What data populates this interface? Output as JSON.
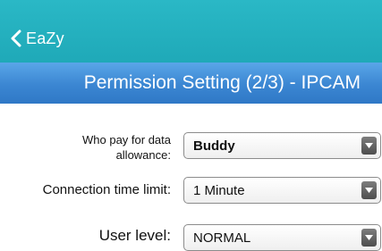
{
  "nav": {
    "back_label": "EaZy",
    "title": "Permission Setting (2/3) - IPCAM"
  },
  "form": {
    "data_allowance": {
      "label_line1": "Who pay for data",
      "label_line2": "allowance:",
      "value": "Buddy"
    },
    "connection_time_limit": {
      "label": "Connection time limit:",
      "value": "1 Minute"
    },
    "user_level": {
      "label": "User level:",
      "value": "NORMAL"
    }
  },
  "colors": {
    "top_bar": "#24b3c2",
    "header": "#3b86d2"
  },
  "icons": {
    "back": "chevron-left-icon",
    "dropdown": "triangle-down-icon"
  }
}
